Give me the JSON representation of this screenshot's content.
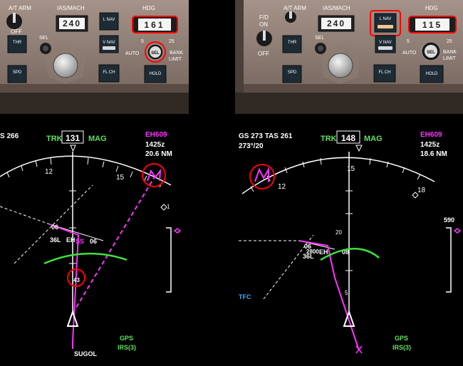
{
  "left": {
    "mcp": {
      "at_arm_label": "A/T ARM",
      "off_label": "OFF",
      "ias_mach_label": "IAS/MACH",
      "ias_value": "240",
      "hdg_label": "HDG",
      "hdg_value": "161",
      "lnav_label": "L NAV",
      "vnav_label": "V NAV",
      "flch_label": "FL CH",
      "hold_label": "HOLD",
      "thr_label": "THR",
      "spd_label": "SPD",
      "sel_label": "SEL",
      "sel_knob_label": "SEL",
      "bank_5": "5",
      "bank_25": "25",
      "auto_label": "AUTO",
      "bank_label": "BANK",
      "limit_label": "LIMIT"
    },
    "nd": {
      "gs_text": "S 266",
      "trk_label": "TRK",
      "trk_value": "131",
      "mag_label": "MAG",
      "waypoint": "EH609",
      "eta": "1425z",
      "distance": "20.6 NM",
      "compass_12": "12",
      "compass_15": "15",
      "rwy_06": "06",
      "rwy_36l": "36L",
      "ap_eh": "EH",
      "ss": "SS",
      "ss06": "06",
      "dot_43": "43",
      "gps": "GPS",
      "irs": "IRS(3)",
      "bottom_fix": "SUGOL"
    }
  },
  "right": {
    "mcp": {
      "fd_on_label": "F/D\nON",
      "off_label": "OFF",
      "at_arm_label": "A/T ARM",
      "ias_mach_label": "IAS/MACH",
      "ias_value": "240",
      "hdg_label": "HDG",
      "hdg_value": "115",
      "lnav_label": "L NAV",
      "vnav_label": "V NAV",
      "flch_label": "FL CH",
      "hold_label": "HOLD",
      "thr_label": "THR",
      "spd_label": "SPD",
      "sel_label": "SEL",
      "sel_knob_label": "SEL",
      "bank_5": "5",
      "bank_25": "25",
      "auto_label": "AUTO",
      "bank_label": "BANK",
      "limit_label": "LIMIT"
    },
    "nd": {
      "gs_text": "GS 273  TAS 261",
      "wind": "273°/20",
      "trk_label": "TRK",
      "trk_value": "148",
      "mag_label": "MAG",
      "waypoint": "EH609",
      "eta": "1425z",
      "distance": "18.6 NM",
      "compass_12": "12",
      "compass_15": "15",
      "compass_18": "18",
      "alt_590": "590",
      "range_20": "20",
      "range_5": "5",
      "rwy_06": "06",
      "rwy_36l": "36L",
      "ap_eh": "EH",
      "r_2800": "2800",
      "r_08": "08",
      "tfc": "TFC",
      "gps": "GPS",
      "irs": "IRS(3)"
    }
  }
}
